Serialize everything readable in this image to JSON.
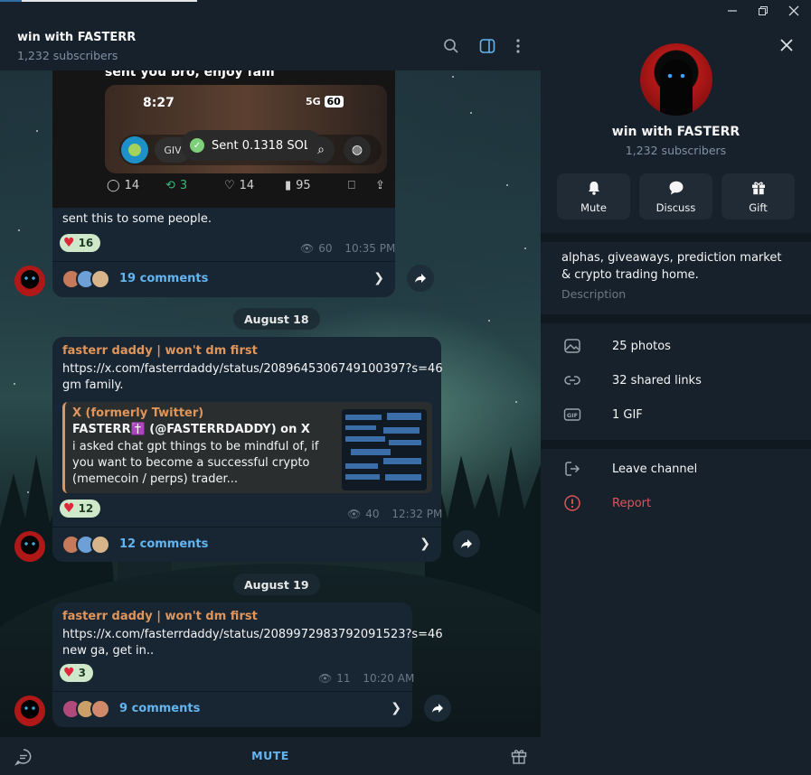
{
  "channel": {
    "title": "win with FASTERR",
    "subscribers": "1,232 subscribers"
  },
  "posts": [
    {
      "image_overlay_text": "sent you bro, enjoy fam",
      "phone_time": "8:27",
      "phone_signal": "5G",
      "phone_battery": "60",
      "gv_label": "GIV",
      "sent_toast": "Sent 0.1318 SOL",
      "tweet_stats": {
        "replies": "14",
        "retweets": "3",
        "likes": "14",
        "views": "95"
      },
      "text": "sent this to some people.",
      "reaction_count": "16",
      "views": "60",
      "time": "10:35 PM",
      "comments": "19 comments"
    },
    {
      "author": "fasterr daddy | won't dm first",
      "link": "https://x.com/fasterrdaddy/status/2089645306749100397?s=46",
      "text": "gm family.",
      "preview": {
        "site": "X (formerly Twitter)",
        "title": "FASTERR✝️ (@FASTERRDADDY) on X",
        "description": "i asked chat gpt things to be mindful of, if you want to become a successful crypto (memecoin / perps) trader..."
      },
      "reaction_count": "12",
      "views": "40",
      "time": "12:32 PM",
      "comments": "12 comments"
    },
    {
      "author": "fasterr daddy | won't dm first",
      "link": "https://x.com/fasterrdaddy/status/2089972983792091523?s=46",
      "text": "new ga, get in..",
      "reaction_count": "3",
      "views": "11",
      "time": "10:20 AM",
      "comments": "9 comments"
    }
  ],
  "dates": [
    "August 18",
    "August 19"
  ],
  "bottom": {
    "mute_label": "MUTE"
  },
  "profile": {
    "name": "win with FASTERR",
    "subscribers": "1,232 subscribers",
    "actions": [
      {
        "label": "Mute",
        "icon": "bell-icon"
      },
      {
        "label": "Discuss",
        "icon": "chat-bubble-icon"
      },
      {
        "label": "Gift",
        "icon": "gift-icon"
      }
    ],
    "description": "alphas, giveaways, prediction market & crypto trading home.",
    "description_label": "Description",
    "media": [
      {
        "label": "25 photos",
        "icon": "photo-icon"
      },
      {
        "label": "32 shared links",
        "icon": "link-icon"
      },
      {
        "label": "1 GIF",
        "icon": "gif-icon"
      }
    ],
    "leave_label": "Leave channel",
    "report_label": "Report"
  },
  "colors": {
    "accent": "#64b5ef",
    "author": "#e0965b",
    "danger": "#e0535a",
    "panel": "#17212b"
  }
}
